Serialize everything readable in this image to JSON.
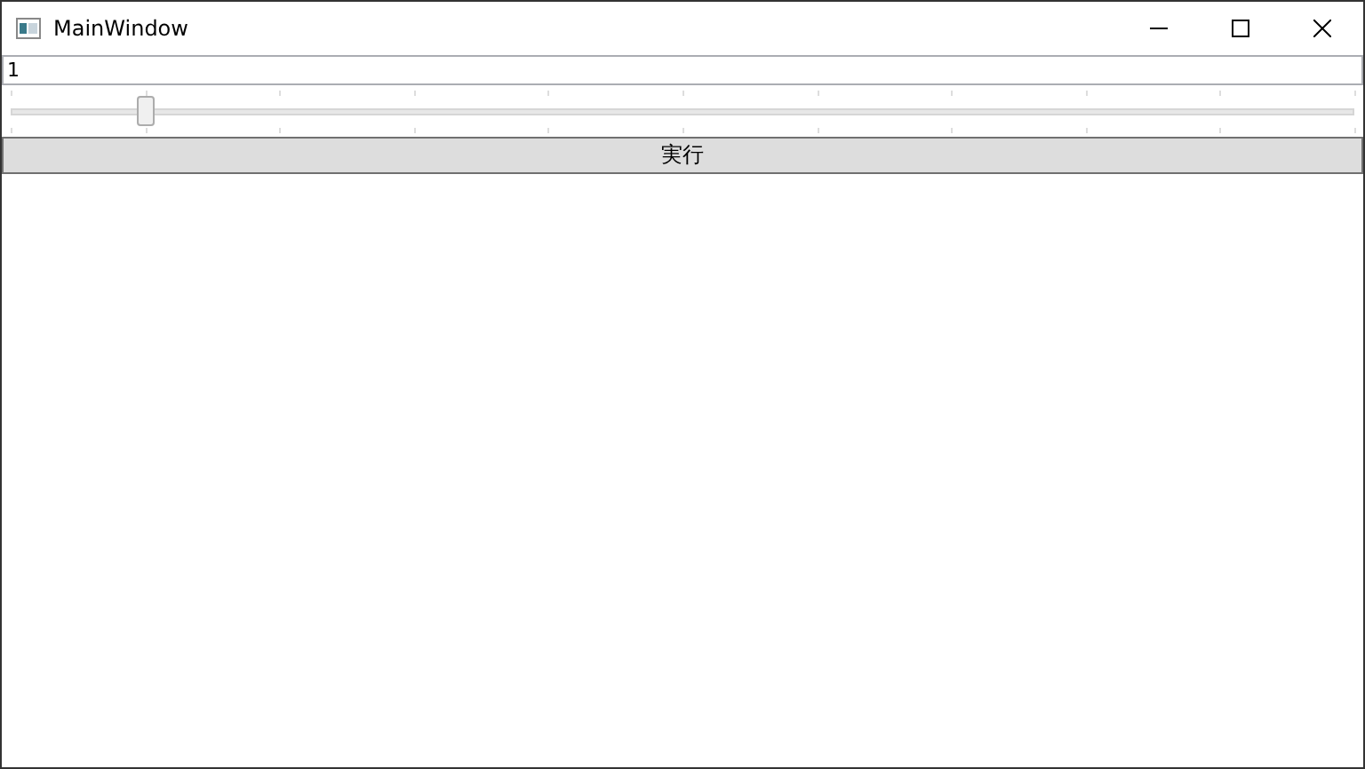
{
  "window": {
    "title": "MainWindow"
  },
  "textbox": {
    "value": "1"
  },
  "slider": {
    "level": 0.1
  },
  "button": {
    "label": "実行"
  }
}
